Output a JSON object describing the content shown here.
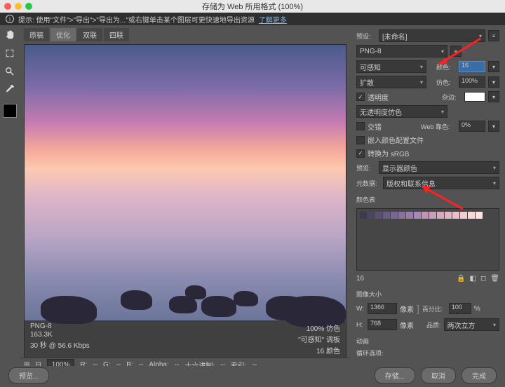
{
  "title": "存储为 Web 所用格式 (100%)",
  "hint": {
    "text": "提示: 使用\"文件\">\"导出\">\"导出为...\"或右键单击某个图层可更快速地导出资源",
    "link": "了解更多"
  },
  "tabs": [
    "原稿",
    "优化",
    "双联",
    "四联"
  ],
  "active_tab": 1,
  "preview_info": {
    "format": "PNG-8",
    "size": "163.3K",
    "time": "30 秒 @ 56.6 Kbps",
    "dither_pct": "100% 仿色",
    "palette": "\"可感知\" 调板",
    "colors": "16 颜色"
  },
  "settings": {
    "preset_label": "预设:",
    "preset_value": "[未命名]",
    "format": "PNG-8",
    "reduction": "可感知",
    "colors_label": "颜色:",
    "colors_value": "16",
    "dither_method": "扩散",
    "dither_label": "仿色:",
    "dither_value": "100%",
    "transparency_label": "透明度",
    "matte_label": "杂边:",
    "trans_dither": "无透明度仿色",
    "interlaced_label": "交错",
    "web_snap_label": "Web 靠色:",
    "web_snap_value": "0%",
    "embed_profile_label": "嵌入颜色配置文件",
    "convert_srgb_label": "转换为 sRGB",
    "preview_label": "预览:",
    "preview_value": "显示器颜色",
    "metadata_label": "元数据:",
    "metadata_value": "版权和联系信息"
  },
  "color_table": {
    "label": "颜色表",
    "colors": [
      "#3b3b4f",
      "#4a4560",
      "#5a5072",
      "#6a5b84",
      "#7a6696",
      "#8a7199",
      "#9a7ca8",
      "#aa87b7",
      "#bf95b5",
      "#c8a0b8",
      "#d5aabf",
      "#e0b5c6",
      "#ebc0cd",
      "#f2ccd0",
      "#f8d8d8",
      "#fde5df"
    ],
    "count": "16"
  },
  "image_size": {
    "label": "图像大小",
    "w_label": "W:",
    "w_value": "1366",
    "h_label": "H:",
    "h_value": "768",
    "unit": "像素",
    "percent_label": "百分比:",
    "percent_value": "100",
    "percent_unit": "%",
    "quality_label": "品质:",
    "quality_value": "两次立方"
  },
  "animation": {
    "label": "动画",
    "loop_label": "循环选项:"
  },
  "footer": {
    "zoom": "100%",
    "r": "R:",
    "g": "G:",
    "b": "B:",
    "alpha": "Alpha:",
    "hex": "十六进制:",
    "index": "索引:"
  },
  "buttons": {
    "preview": "预览...",
    "save": "存储...",
    "cancel": "取消",
    "done": "完成"
  }
}
